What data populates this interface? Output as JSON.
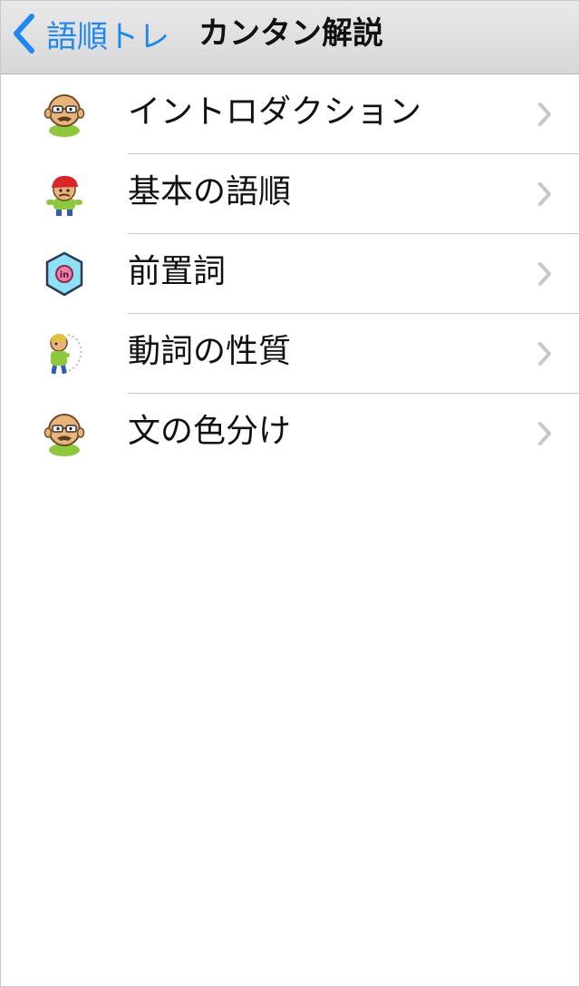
{
  "nav": {
    "back_label": "語順トレ",
    "title": "カンタン解説"
  },
  "items": [
    {
      "label": "イントロダクション",
      "icon": "bald-man-icon"
    },
    {
      "label": "基本の語順",
      "icon": "red-cap-character-icon"
    },
    {
      "label": "前置詞",
      "icon": "in-hexagon-icon"
    },
    {
      "label": "動詞の性質",
      "icon": "walking-character-icon"
    },
    {
      "label": "文の色分け",
      "icon": "bald-man-icon"
    }
  ],
  "colors": {
    "accent": "#1e88f0",
    "navbar_top": "#e9e9e9",
    "navbar_bottom": "#d7d7d7",
    "separator": "#c8c8c8",
    "chevron": "#c7c7cc",
    "hexagon_fill": "#8ee0f4"
  }
}
